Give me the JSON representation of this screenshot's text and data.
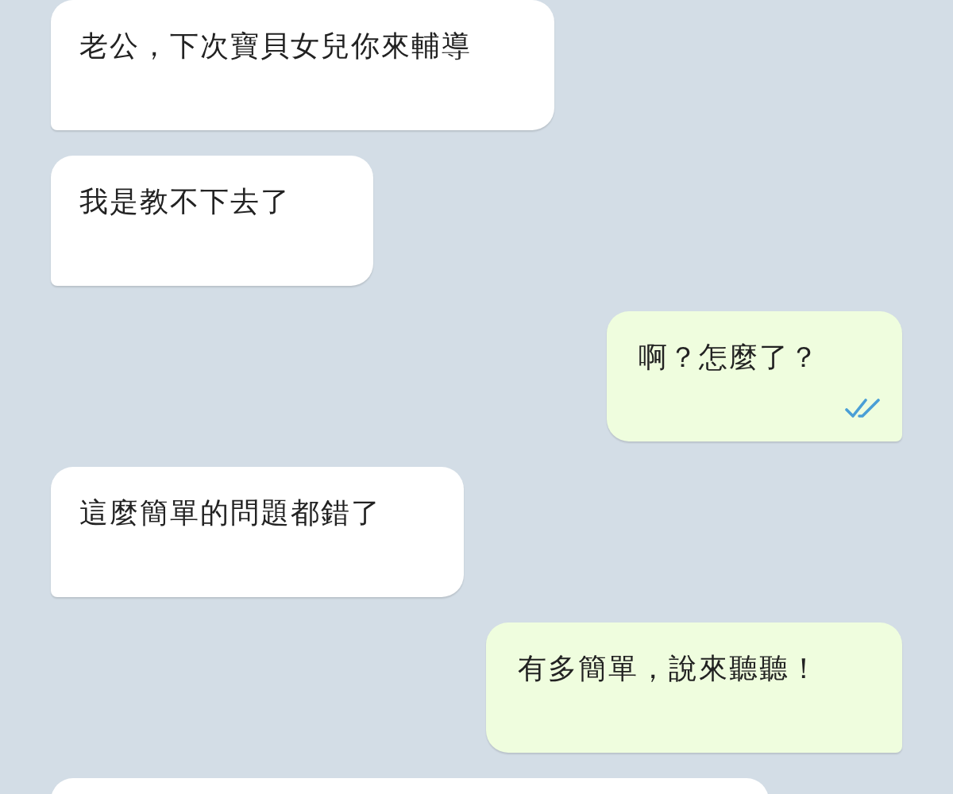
{
  "messages": [
    {
      "kind": "incoming",
      "text": "老公，下次寶貝女兒你來輔導"
    },
    {
      "kind": "incoming",
      "text": "我是教不下去了"
    },
    {
      "kind": "outgoing",
      "text": "啊？怎麼了？",
      "read": true
    },
    {
      "kind": "incoming",
      "text": "這麼簡單的問題都錯了"
    },
    {
      "kind": "outgoing",
      "text": "有多簡單，說來聽聽！",
      "read": false
    },
    {
      "kind": "incoming"
    }
  ]
}
